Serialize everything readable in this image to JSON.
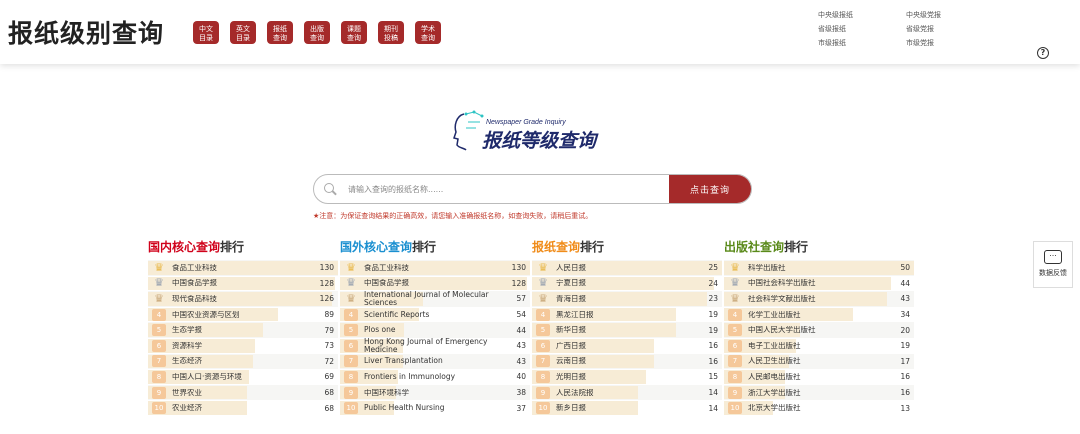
{
  "header": {
    "title": "报纸级别查询",
    "nav": [
      "中文目录",
      "英文目录",
      "报纸查询",
      "出版查询",
      "课题查询",
      "期刊投稿",
      "学术查询"
    ],
    "links": [
      "中央级报纸",
      "中央级党报",
      "省级报纸",
      "省级党报",
      "市级报纸",
      "市级党报"
    ]
  },
  "logo": {
    "subtitle": "Newspaper Grade Inquiry",
    "title": "报纸等级查询"
  },
  "search": {
    "placeholder": "请输入查询的报纸名称......",
    "button": "点击查询"
  },
  "notice": "★注意：为保证查询结果的正确高效，请您输入准确报纸名称，如查询失败，请稍后重试。",
  "colors": {
    "brand": "#a52a2a",
    "red": "#d0021b",
    "blue": "#1a8fd0",
    "orange": "#f08c1a",
    "green": "#5a8a1a"
  },
  "rankings": [
    {
      "title_hl": "国内核心查询",
      "title_rest": "排行",
      "color": "#d0021b",
      "max": 130,
      "rows": [
        {
          "name": "食品工业科技",
          "value": 130
        },
        {
          "name": "中国食品学报",
          "value": 128
        },
        {
          "name": "现代食品科技",
          "value": 126
        },
        {
          "name": "中国农业资源与区划",
          "value": 89
        },
        {
          "name": "生态学报",
          "value": 79
        },
        {
          "name": "资源科学",
          "value": 73
        },
        {
          "name": "生态经济",
          "value": 72
        },
        {
          "name": "中国人口·资源与环境",
          "value": 69
        },
        {
          "name": "世界农业",
          "value": 68
        },
        {
          "name": "农业经济",
          "value": 68
        }
      ]
    },
    {
      "title_hl": "国外核心查询",
      "title_rest": "排行",
      "color": "#1a8fd0",
      "max": 130,
      "rows": [
        {
          "name": "食品工业科技",
          "value": 130
        },
        {
          "name": "中国食品学报",
          "value": 128
        },
        {
          "name": "International Journal of Molecular Sciences",
          "value": 57
        },
        {
          "name": "Scientific Reports",
          "value": 54
        },
        {
          "name": "Plos one",
          "value": 44
        },
        {
          "name": "Hong Kong Journal of Emergency Medicine",
          "value": 43
        },
        {
          "name": "Liver Transplantation",
          "value": 43
        },
        {
          "name": "Frontiers in Immunology",
          "value": 40
        },
        {
          "name": "中国环境科学",
          "value": 38
        },
        {
          "name": "Public Health Nursing",
          "value": 37
        }
      ]
    },
    {
      "title_hl": "报纸查询",
      "title_rest": "排行",
      "color": "#f08c1a",
      "max": 25,
      "rows": [
        {
          "name": "人民日报",
          "value": 25
        },
        {
          "name": "宁夏日报",
          "value": 24
        },
        {
          "name": "青海日报",
          "value": 23
        },
        {
          "name": "黑龙江日报",
          "value": 19
        },
        {
          "name": "新华日报",
          "value": 19
        },
        {
          "name": "广西日报",
          "value": 16
        },
        {
          "name": "云南日报",
          "value": 16
        },
        {
          "name": "光明日报",
          "value": 15
        },
        {
          "name": "人民法院报",
          "value": 14
        },
        {
          "name": "新乡日报",
          "value": 14
        }
      ]
    },
    {
      "title_hl": "出版社查询",
      "title_rest": "排行",
      "color": "#5a8a1a",
      "max": 50,
      "rows": [
        {
          "name": "科学出版社",
          "value": 50
        },
        {
          "name": "中国社会科学出版社",
          "value": 44
        },
        {
          "name": "社会科学文献出版社",
          "value": 43
        },
        {
          "name": "化学工业出版社",
          "value": 34
        },
        {
          "name": "中国人民大学出版社",
          "value": 20
        },
        {
          "name": "电子工业出版社",
          "value": 19
        },
        {
          "name": "人民卫生出版社",
          "value": 17
        },
        {
          "name": "人民邮电出版社",
          "value": 16
        },
        {
          "name": "浙江大学出版社",
          "value": 16
        },
        {
          "name": "北京大学出版社",
          "value": 13
        }
      ]
    }
  ],
  "feedback": "数据反馈"
}
